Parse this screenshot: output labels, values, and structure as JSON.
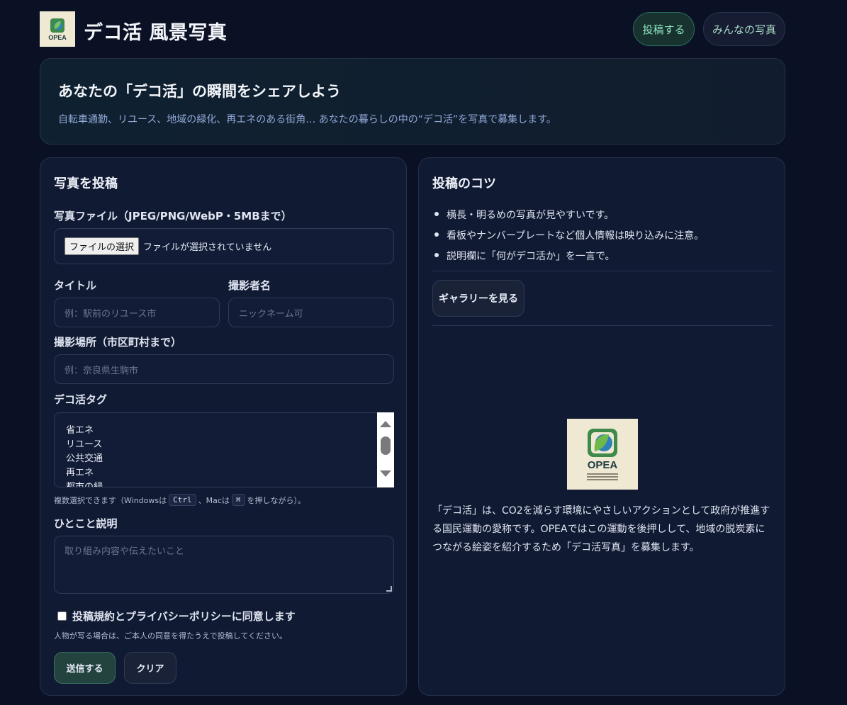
{
  "header": {
    "logo_text": "OPEA",
    "title": "デコ活 風景写真",
    "nav": {
      "post": "投稿する",
      "gallery": "みんなの写真"
    }
  },
  "hero": {
    "title": "あなたの「デコ活」の瞬間をシェアしよう",
    "subtitle": "自転車通勤、リユース、地域の緑化、再エネのある街角… あなたの暮らしの中の“デコ活”を写真で募集します。"
  },
  "form": {
    "title": "写真を投稿",
    "file_label": "写真ファイル（JPEG/PNG/WebP・5MBまで）",
    "file_button": "ファイルの選択",
    "file_status": "ファイルが選択されていません",
    "title_label": "タイトル",
    "title_placeholder": "例：駅前のリユース市",
    "photographer_label": "撮影者名",
    "photographer_placeholder": "ニックネーム可",
    "location_label": "撮影場所（市区町村まで）",
    "location_placeholder": "例：奈良県生駒市",
    "tags_label": "デコ活タグ",
    "tags": [
      "省エネ",
      "リユース",
      "公共交通",
      "再エネ",
      "都市の緑"
    ],
    "hint_prefix": "複数選択できます（Windowsは",
    "hint_ctrl": "Ctrl",
    "hint_mid": "、Macは",
    "hint_cmd": "⌘",
    "hint_suffix": "を押しながら）。",
    "desc_label": "ひとこと説明",
    "desc_placeholder": "取り組み内容や伝えたいこと",
    "consent": "投稿規約とプライバシーポリシーに同意します",
    "note": "人物が写る場合は、ご本人の同意を得たうえで投稿してください。",
    "submit": "送信する",
    "clear": "クリア"
  },
  "tips": {
    "title": "投稿のコツ",
    "items": [
      "横長・明るめの写真が見やすいです。",
      "看板やナンバープレートなど個人情報は映り込みに注意。",
      "説明欄に「何がデコ活か」を一言で。"
    ],
    "gallery_button": "ギャラリーを見る",
    "logo_text": "OPEA",
    "about": "「デコ活」は、CO2を減らす環境にやさしいアクションとして政府が推進する国民運動の愛称です。OPEAではこの運動を後押しして、地域の脱炭素につながる絵姿を紹介するため「デコ活写真」を募集します。"
  },
  "colors": {
    "background": "#0b1124",
    "panel": "#111a33",
    "accent": "#8fe7c2",
    "subtitle": "#93a8d8"
  }
}
